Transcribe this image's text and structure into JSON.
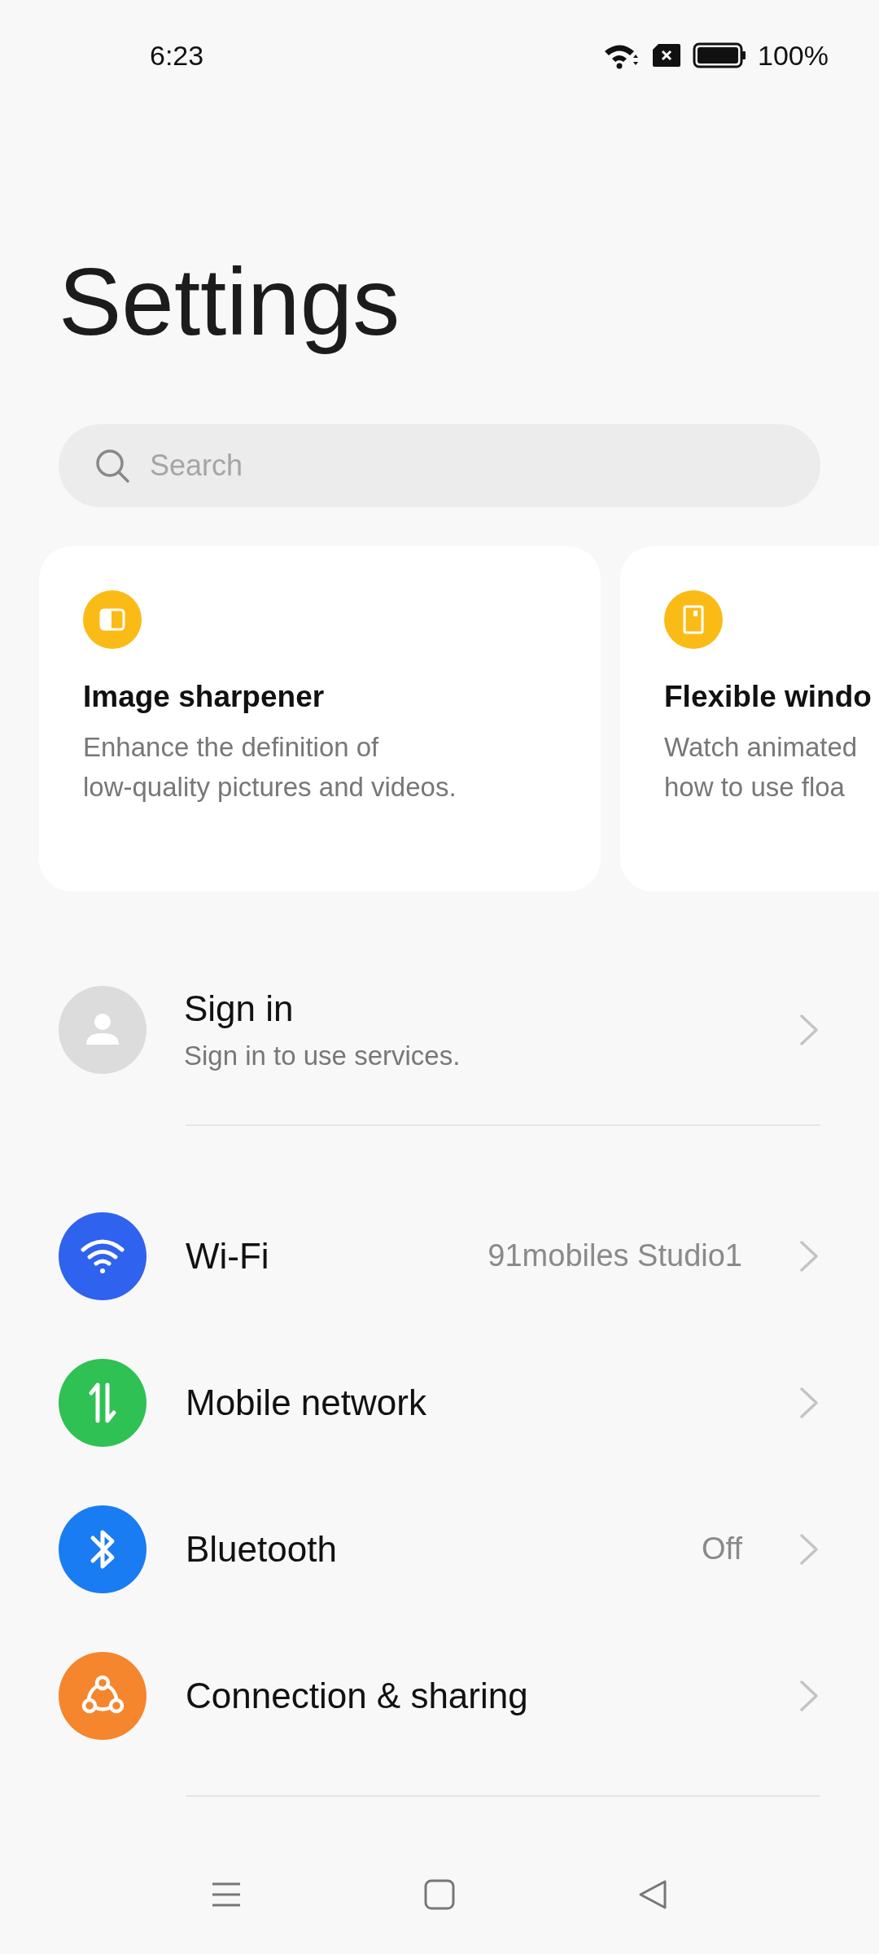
{
  "status_bar": {
    "time": "6:23",
    "battery": "100%"
  },
  "title": "Settings",
  "search": {
    "placeholder": "Search"
  },
  "feature_cards": [
    {
      "kind": "sharpener",
      "title": "Image sharpener",
      "lines": [
        "Enhance the definition of",
        "low-quality pictures and videos."
      ]
    },
    {
      "kind": "window",
      "title": "Flexible windo",
      "lines": [
        "Watch animated",
        "how to use floa"
      ]
    }
  ],
  "account": {
    "title": "Sign in",
    "subtitle": "Sign in to use services."
  },
  "settings": [
    {
      "kind": "wifi",
      "label": "Wi-Fi",
      "value": "91mobiles Studio1",
      "color": "#2f62ee"
    },
    {
      "kind": "mobile",
      "label": "Mobile network",
      "color": "#2fc153"
    },
    {
      "kind": "bluetooth",
      "label": "Bluetooth",
      "value": "Off",
      "color": "#1a7cf2"
    },
    {
      "kind": "sharing",
      "label": "Connection & sharing",
      "color": "#f5862d"
    }
  ]
}
